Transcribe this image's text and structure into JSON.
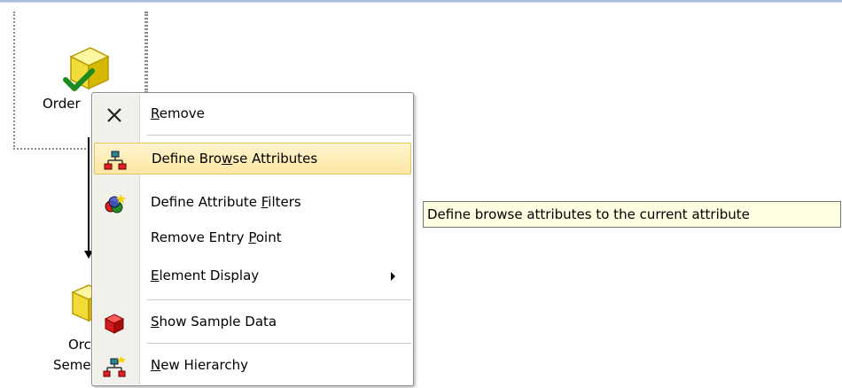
{
  "canvas": {
    "node_top": {
      "label": "Order",
      "icon": "cube-check-icon"
    },
    "node_bottom": {
      "label_line1": "Orc",
      "label_line2": "Seme",
      "icon": "cube-icon"
    }
  },
  "menu": {
    "items": [
      {
        "pre": "",
        "u": "R",
        "post": "emove",
        "icon": "close-x-icon"
      },
      {
        "pre": "Define Bro",
        "u": "w",
        "post": "se Attributes",
        "icon": "browse-attributes-icon",
        "highlighted": true
      },
      {
        "pre": "Define Attribute ",
        "u": "F",
        "post": "ilters",
        "icon": "attribute-filters-icon"
      },
      {
        "pre": "Remove Entry ",
        "u": "P",
        "post": "oint",
        "icon": ""
      },
      {
        "pre": "",
        "u": "E",
        "post": "lement Display",
        "icon": "",
        "has_submenu": true
      },
      {
        "pre": "",
        "u": "S",
        "post": "how Sample Data",
        "icon": "sample-data-icon"
      },
      {
        "pre": "",
        "u": "N",
        "post": "ew Hierarchy",
        "icon": "new-hierarchy-icon"
      }
    ]
  },
  "tooltip": {
    "text": "Define browse attributes to the current attribute"
  },
  "colors": {
    "highlight": "#fde7a4",
    "highlight_border": "#e9c464",
    "tooltip_bg": "#ffffe1"
  }
}
